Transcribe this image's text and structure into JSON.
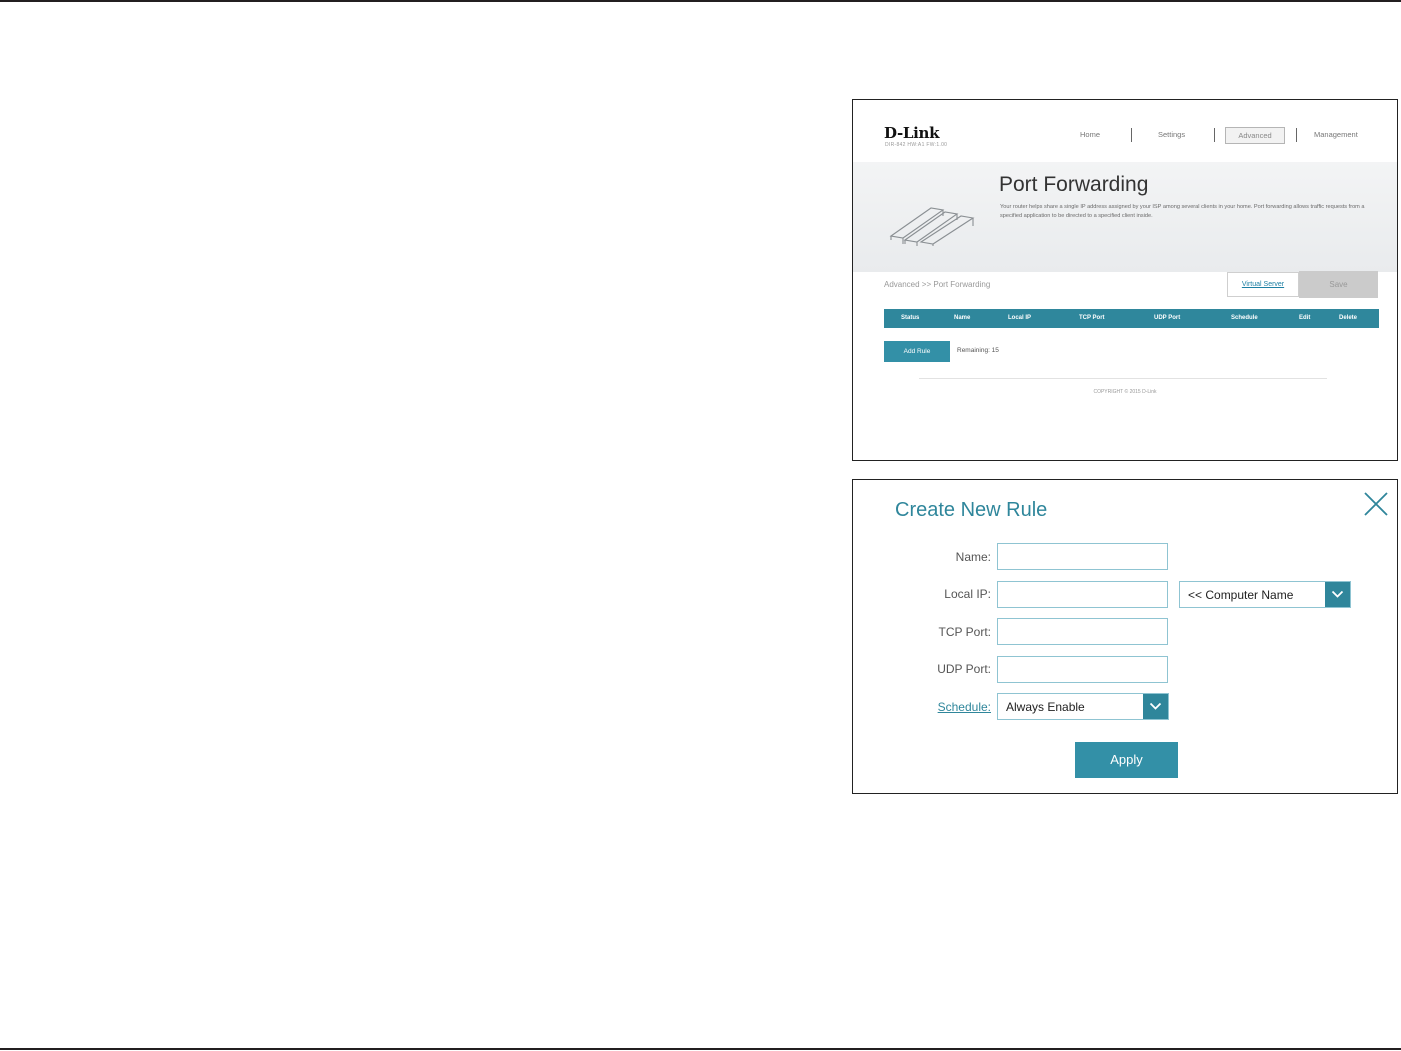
{
  "port_forwarding": {
    "logo": "D-Link",
    "logo_sub": "DIR-842   HW:A1   FW:1.00",
    "nav": {
      "home": "Home",
      "settings": "Settings",
      "advanced": "Advanced",
      "management": "Management"
    },
    "title": "Port Forwarding",
    "description": "Your router helps share a single IP address assigned by your ISP among several clients in your home. Port forwarding allows traffic requests from a specified application to be directed to a specified client inside.",
    "breadcrumb": "Advanced >> Port Forwarding",
    "virtual_server_label": "Virtual Server",
    "save_label": "Save",
    "columns": [
      "Status",
      "Name",
      "Local IP",
      "TCP Port",
      "UDP Port",
      "Schedule",
      "Edit",
      "Delete"
    ],
    "add_rule_label": "Add Rule",
    "remaining": "Remaining: 15",
    "copyright": "COPYRIGHT © 2015 D-Link"
  },
  "create_rule": {
    "title": "Create New Rule",
    "fields": {
      "name_label": "Name:",
      "name_value": "",
      "local_ip_label": "Local IP:",
      "local_ip_value": "",
      "computer_name_option": "<< Computer Name",
      "tcp_port_label": "TCP Port:",
      "tcp_port_value": "",
      "udp_port_label": "UDP Port:",
      "udp_port_value": "",
      "schedule_label": "Schedule:",
      "schedule_value": "Always Enable"
    },
    "apply_label": "Apply"
  },
  "icons": {
    "close": "close-icon",
    "dropdown": "chevron-down-icon"
  },
  "colors": {
    "accent": "#2f869b",
    "button": "#3390a7",
    "table_header": "#2f879c",
    "save_disabled": "#cbcbcb"
  }
}
